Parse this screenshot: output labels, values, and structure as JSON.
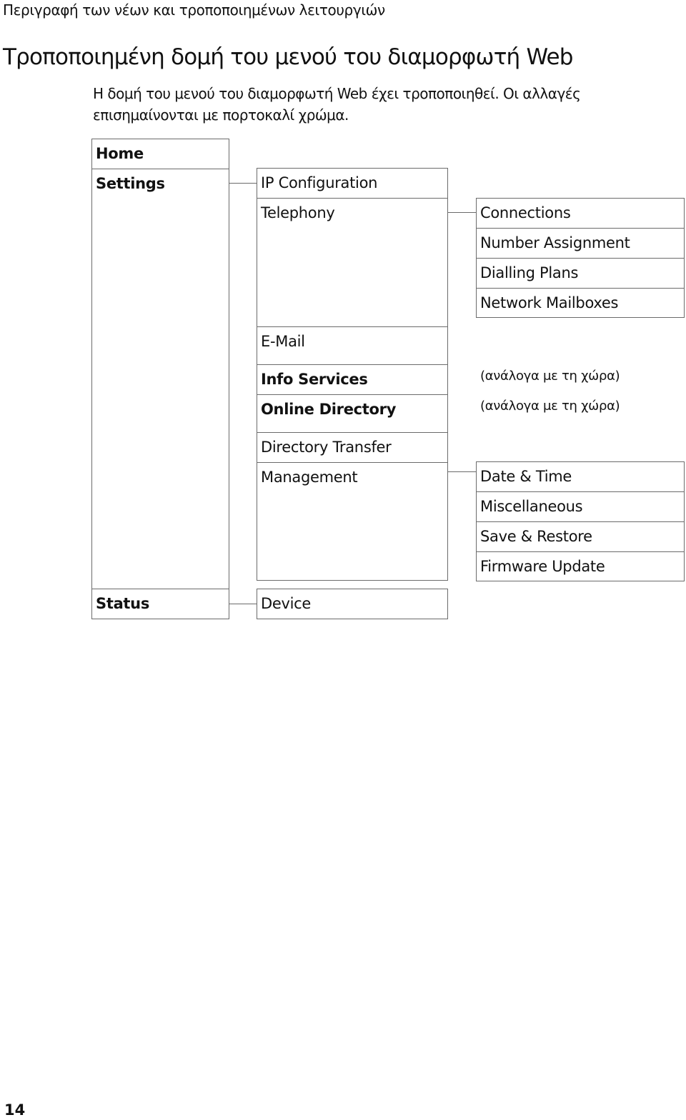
{
  "header": {
    "running_head": "Περιγραφή των νέων και τροποποιημένων λειτουργιών",
    "title": "Τροποποιημένη δομή του μενού του διαμορφωτή Web",
    "intro_line1": "Η δομή του μενού του διαμορφωτή Web έχει τροποποιηθεί. Οι αλλαγές",
    "intro_line2": "επισημαίνονται με πορτοκαλί χρώμα."
  },
  "menu_tree": {
    "level1": [
      {
        "label": "Home",
        "bold": true
      },
      {
        "label": "Settings",
        "bold": true
      },
      {
        "label": "Status",
        "bold": true
      }
    ],
    "settings_children": [
      {
        "label": "IP Configuration",
        "bold": false
      },
      {
        "label": "Telephony",
        "bold": false
      },
      {
        "label": "E-Mail",
        "bold": false
      },
      {
        "label": "Info Services",
        "bold": true,
        "note": "(ανάλογα με τη χώρα)"
      },
      {
        "label": "Online Directory",
        "bold": true,
        "note": "(ανάλογα με τη χώρα)"
      },
      {
        "label": "Directory Transfer",
        "bold": false
      },
      {
        "label": "Management",
        "bold": false
      }
    ],
    "telephony_children": [
      {
        "label": "Connections"
      },
      {
        "label": "Number Assignment"
      },
      {
        "label": "Dialling Plans"
      },
      {
        "label": "Network Mailboxes"
      }
    ],
    "management_children": [
      {
        "label": "Date & Time"
      },
      {
        "label": "Miscellaneous"
      },
      {
        "label": "Save & Restore"
      },
      {
        "label": "Firmware Update"
      }
    ],
    "status_children": [
      {
        "label": "Device"
      }
    ]
  },
  "footer": {
    "page_number": "14"
  }
}
